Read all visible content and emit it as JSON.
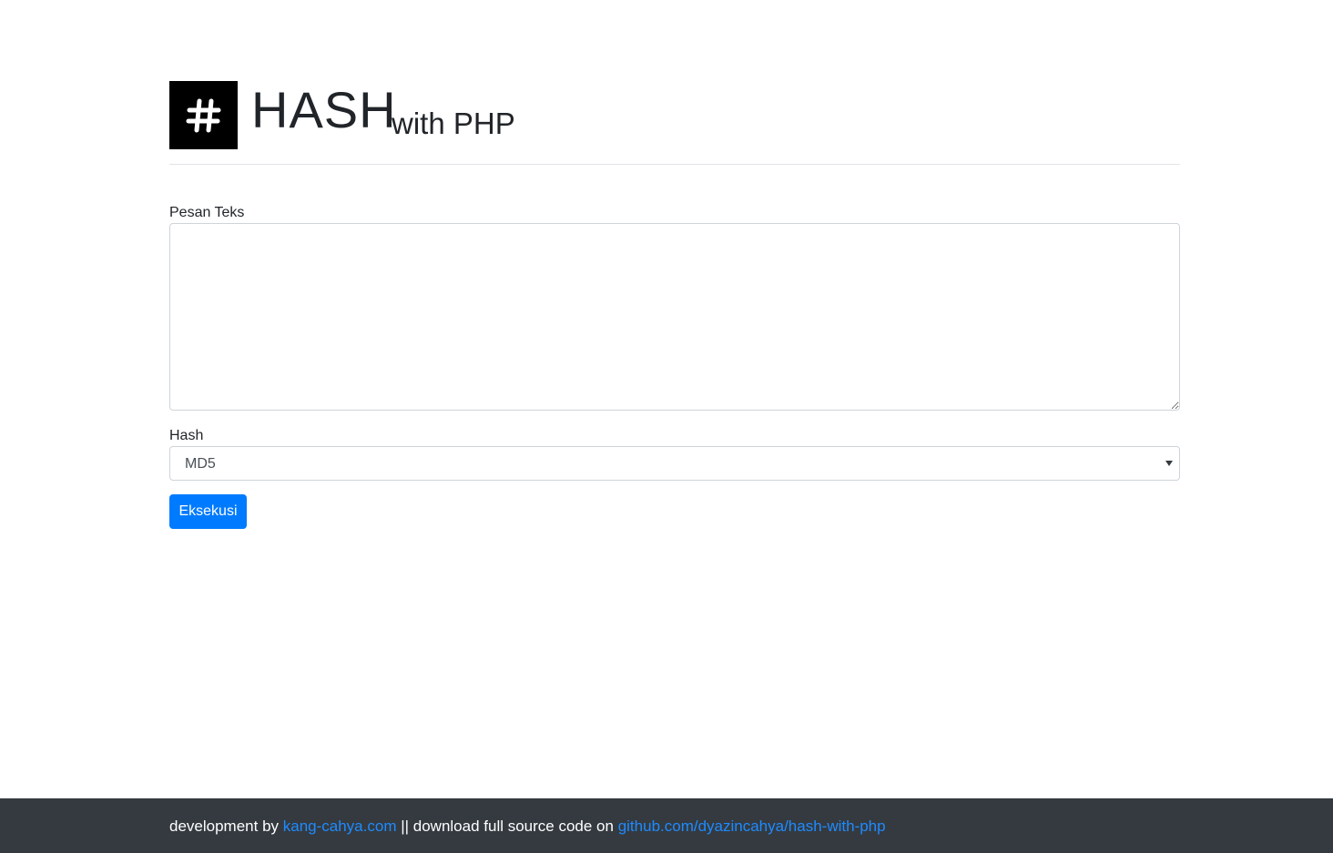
{
  "header": {
    "logo_icon": "hash-icon",
    "title": "HASH",
    "subtitle": "with PHP"
  },
  "form": {
    "message_label": "Pesan Teks",
    "message_value": "",
    "hash_label": "Hash",
    "hash_selected": "MD5",
    "submit_label": "Eksekusi"
  },
  "footer": {
    "prefix": "development by ",
    "author_link": "kang-cahya.com",
    "middle": " || download full source code on ",
    "repo_link": "github.com/dyazincahya/hash-with-php"
  },
  "colors": {
    "primary": "#007bff",
    "footer_bg": "#343a40",
    "link": "#1e8bff"
  }
}
